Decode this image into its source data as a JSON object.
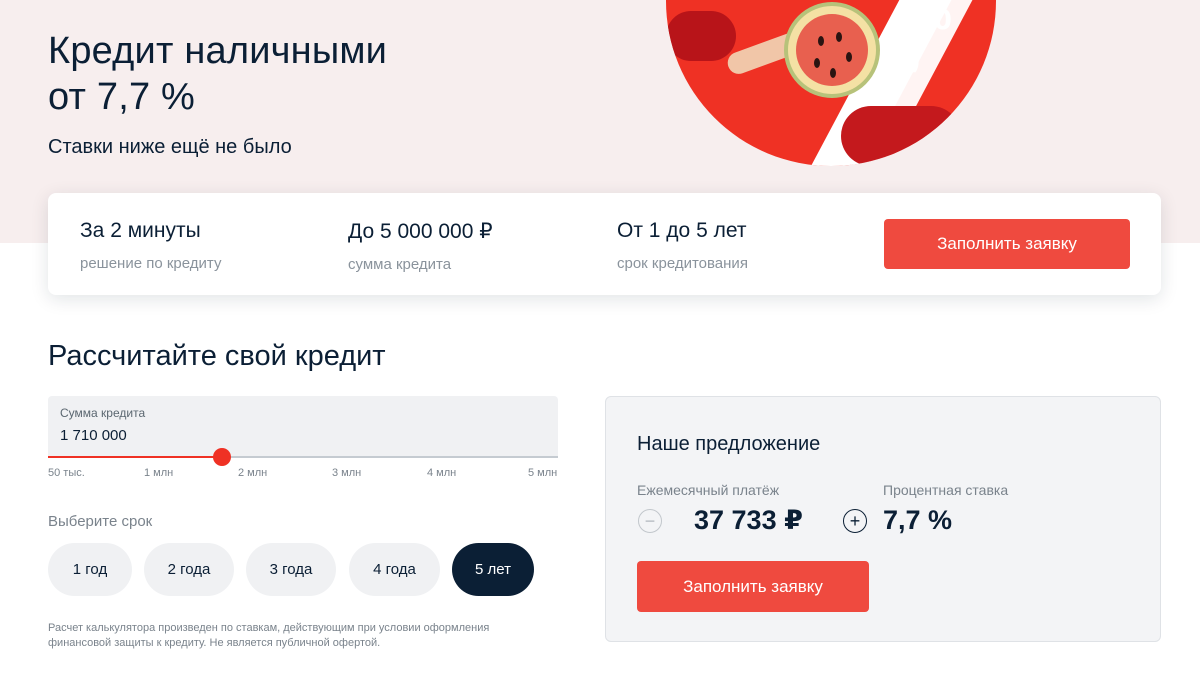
{
  "hero": {
    "title_line1": "Кредит наличными",
    "title_line2": "от 7,7 %",
    "subtitle": "Ставки ниже ещё не было",
    "promo_rate_text": "%",
    "promo_comma": ","
  },
  "features": [
    {
      "title": "За 2 минуты",
      "subtitle": "решение по кредиту"
    },
    {
      "title": "До 5 000 000 ₽",
      "subtitle": "сумма кредита"
    },
    {
      "title": "От 1 до 5 лет",
      "subtitle": "срок кредитования"
    }
  ],
  "apply_button_label": "Заполнить заявку",
  "calculator": {
    "title": "Рассчитайте свой кредит",
    "amount_label": "Сумма кредита",
    "amount_value": "1 710 000",
    "slider_ticks": [
      "50 тыс.",
      "1 млн",
      "2 млн",
      "3 млн",
      "4 млн",
      "5 млн"
    ],
    "term_label": "Выберите срок",
    "terms": [
      "1 год",
      "2 года",
      "3 года",
      "4 года",
      "5 лет"
    ],
    "selected_term": "5 лет",
    "disclaimer": "Расчет калькулятора произведен по ставкам, действующим при условии оформления финансовой защиты к кредиту. Не является публичной офертой."
  },
  "offer": {
    "title": "Наше предложение",
    "payment_label": "Ежемесячный платёж",
    "payment_value": "37 733 ₽",
    "rate_label": "Процентная ставка",
    "rate_value": "7,7 %",
    "minus_symbol": "−",
    "plus_symbol": "+",
    "button_label": "Заполнить заявку"
  },
  "colors": {
    "accent": "#ef3124",
    "button": "#ef4a3f",
    "text_dark": "#0b1f35",
    "hero_bg": "#f7eeee"
  }
}
